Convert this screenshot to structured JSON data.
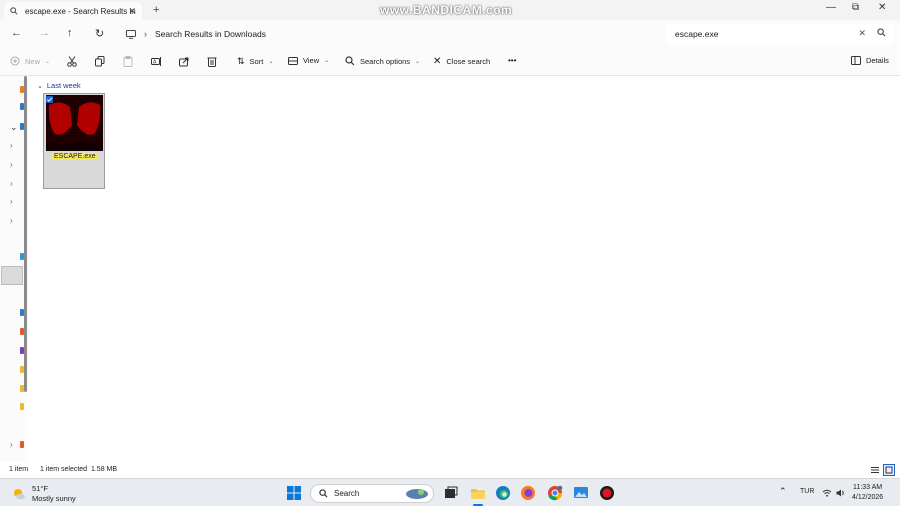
{
  "window": {
    "tab_title": "escape.exe - Search Results in",
    "new_tab_symbol": "+",
    "watermark": "www.BANDICAM.com"
  },
  "address": {
    "breadcrumb": "Search Results in Downloads",
    "search_value": "escape.exe"
  },
  "toolbar": {
    "new_label": "New",
    "sort_label": "Sort",
    "view_label": "View",
    "search_options_label": "Search options",
    "close_search_label": "Close search",
    "more_label": "•••",
    "details_label": "Details"
  },
  "content": {
    "group_label": "Last week",
    "files": [
      {
        "name": "ESCAPE.exe",
        "selected": true
      }
    ]
  },
  "status": {
    "item_count": "1 item",
    "selection": "1 item selected  1.58 MB"
  },
  "taskbar": {
    "temperature": "51°F",
    "weather_desc": "Mostly sunny",
    "search_label": "Search",
    "language": "TUR",
    "time": "11:33 AM",
    "date": "4/12/2026"
  },
  "colors": {
    "accent": "#1e63d6",
    "selection_bg": "#d9d9d9",
    "highlight": "#f1e85a",
    "thumb_red": "#b00000"
  }
}
